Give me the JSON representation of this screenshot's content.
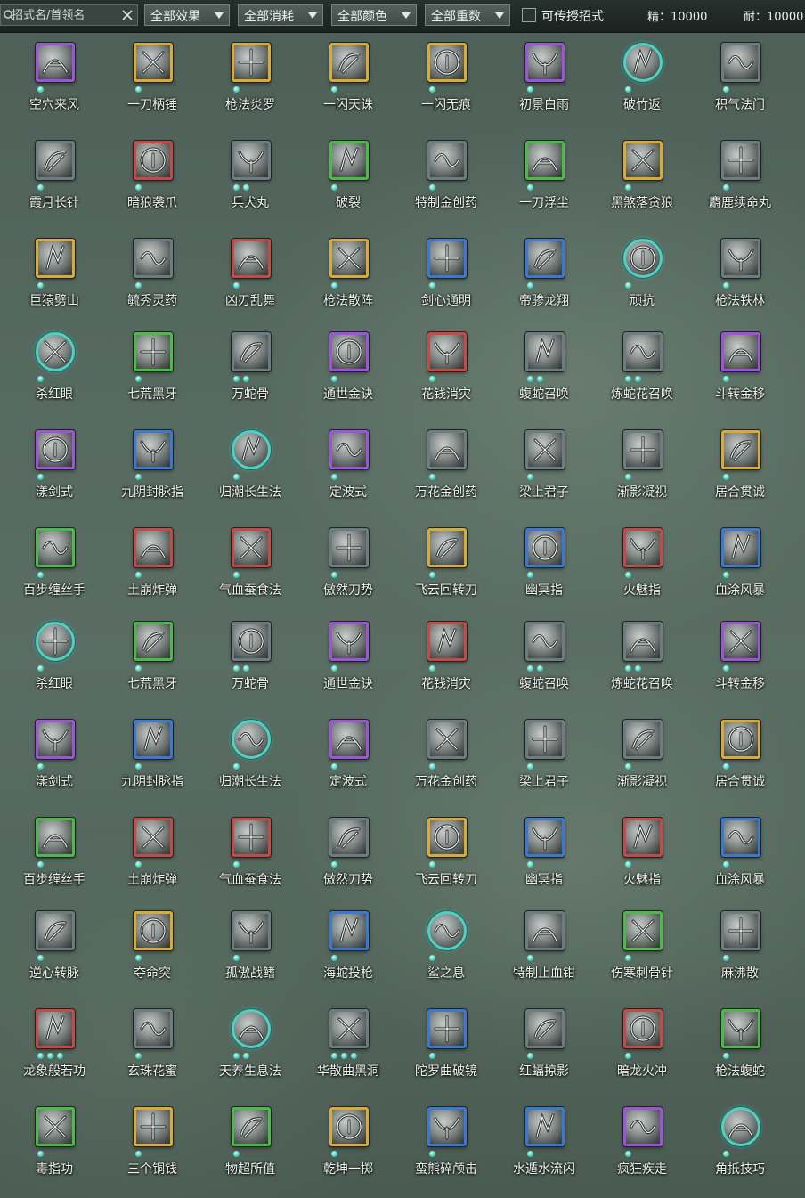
{
  "toolbar": {
    "search_placeholder": "招式名/首领名",
    "search_icon": "search-icon",
    "clear_icon": "close-icon",
    "filters": [
      {
        "label": "全部效果"
      },
      {
        "label": "全部消耗"
      },
      {
        "label": "全部颜色"
      },
      {
        "label": "全部重数"
      }
    ],
    "transferable_label": "可传授招式",
    "transferable_checked": false,
    "jing_label": "精：10000",
    "nai_label": "耐：10000",
    "jing_icon": "moon-crescent-purple-icon",
    "nai_icon": "moon-crescent-orange-icon"
  },
  "colors": {
    "purple": "#9b55d6",
    "gold": "#d7aa3a",
    "red": "#c44a47",
    "green": "#4fb84b",
    "blue": "#3d78d0",
    "gray": "#6d7c80",
    "teal": "#4fd0c2",
    "pip": "#43cdbb"
  },
  "skills": [
    [
      {
        "name": "空穴来风",
        "frame": "purple",
        "pips": 1
      },
      {
        "name": "一刀柄锤",
        "frame": "gold",
        "pips": 1
      },
      {
        "name": "枪法炎罗",
        "frame": "gold",
        "pips": 1
      },
      {
        "name": "一闪天诛",
        "frame": "gold",
        "pips": 1
      },
      {
        "name": "一闪无痕",
        "frame": "gold",
        "pips": 1
      },
      {
        "name": "初景白雨",
        "frame": "purple",
        "pips": 1
      },
      {
        "name": "破竹返",
        "frame": "round",
        "pips": 1
      },
      {
        "name": "积气法门",
        "frame": "gray",
        "pips": 1
      }
    ],
    [
      {
        "name": "霞月长针",
        "frame": "gray",
        "pips": 1
      },
      {
        "name": "暗狼袭爪",
        "frame": "red",
        "pips": 1
      },
      {
        "name": "兵犬丸",
        "frame": "gray",
        "pips": 2
      },
      {
        "name": "破裂",
        "frame": "green",
        "pips": 1
      },
      {
        "name": "特制金创药",
        "frame": "gray",
        "pips": 1
      },
      {
        "name": "一刀浮尘",
        "frame": "green",
        "pips": 1
      },
      {
        "name": "黑煞落贪狼",
        "frame": "gold",
        "pips": 1
      },
      {
        "name": "麝鹿续命丸",
        "frame": "gray",
        "pips": 1
      }
    ],
    [
      {
        "name": "巨猿劈山",
        "frame": "gold",
        "pips": 1
      },
      {
        "name": "毓秀灵药",
        "frame": "gray",
        "pips": 1
      },
      {
        "name": "凶刃乱舞",
        "frame": "red",
        "pips": 1
      },
      {
        "name": "枪法散阵",
        "frame": "gold",
        "pips": 1
      },
      {
        "name": "剑心通明",
        "frame": "blue",
        "pips": 1
      },
      {
        "name": "帝骖龙翔",
        "frame": "blue",
        "pips": 1
      },
      {
        "name": "顽抗",
        "frame": "round",
        "pips": 1
      },
      {
        "name": "枪法铁林",
        "frame": "gray",
        "pips": 1
      }
    ],
    [
      {
        "name": "杀红眼",
        "frame": "round",
        "pips": 1
      },
      {
        "name": "七荒黑牙",
        "frame": "green",
        "pips": 1
      },
      {
        "name": "万蛇骨",
        "frame": "gray",
        "pips": 2
      },
      {
        "name": "通世金诀",
        "frame": "purple",
        "pips": 1
      },
      {
        "name": "花钱消灾",
        "frame": "red",
        "pips": 1
      },
      {
        "name": "蝮蛇召唤",
        "frame": "gray",
        "pips": 2
      },
      {
        "name": "炼蛇花召唤",
        "frame": "gray",
        "pips": 2
      },
      {
        "name": "斗转金移",
        "frame": "purple",
        "pips": 1
      }
    ],
    [
      {
        "name": "漾剑式",
        "frame": "purple",
        "pips": 1
      },
      {
        "name": "九阴封脉指",
        "frame": "blue",
        "pips": 1
      },
      {
        "name": "归潮长生法",
        "frame": "round",
        "pips": 1
      },
      {
        "name": "定波式",
        "frame": "purple",
        "pips": 1
      },
      {
        "name": "万花金创药",
        "frame": "gray",
        "pips": 1
      },
      {
        "name": "梁上君子",
        "frame": "gray",
        "pips": 1
      },
      {
        "name": "渐影凝视",
        "frame": "gray",
        "pips": 1
      },
      {
        "name": "居合贯诚",
        "frame": "gold",
        "pips": 1
      }
    ],
    [
      {
        "name": "百步缠丝手",
        "frame": "green",
        "pips": 1
      },
      {
        "name": "土崩炸弹",
        "frame": "red",
        "pips": 1
      },
      {
        "name": "气血蚕食法",
        "frame": "red",
        "pips": 1
      },
      {
        "name": "傲然刀势",
        "frame": "gray",
        "pips": 1
      },
      {
        "name": "飞云回转刀",
        "frame": "gold",
        "pips": 1
      },
      {
        "name": "幽冥指",
        "frame": "blue",
        "pips": 1
      },
      {
        "name": "火魅指",
        "frame": "red",
        "pips": 1
      },
      {
        "name": "血涂风暴",
        "frame": "blue",
        "pips": 1
      }
    ],
    [
      {
        "name": "杀红眼",
        "frame": "round",
        "pips": 1
      },
      {
        "name": "七荒黑牙",
        "frame": "green",
        "pips": 1
      },
      {
        "name": "万蛇骨",
        "frame": "gray",
        "pips": 2
      },
      {
        "name": "通世金诀",
        "frame": "purple",
        "pips": 1
      },
      {
        "name": "花钱消灾",
        "frame": "red",
        "pips": 1
      },
      {
        "name": "蝮蛇召唤",
        "frame": "gray",
        "pips": 2
      },
      {
        "name": "炼蛇花召唤",
        "frame": "gray",
        "pips": 2
      },
      {
        "name": "斗转金移",
        "frame": "purple",
        "pips": 1
      }
    ],
    [
      {
        "name": "漾剑式",
        "frame": "purple",
        "pips": 1
      },
      {
        "name": "九阴封脉指",
        "frame": "blue",
        "pips": 1
      },
      {
        "name": "归潮长生法",
        "frame": "round",
        "pips": 1
      },
      {
        "name": "定波式",
        "frame": "purple",
        "pips": 1
      },
      {
        "name": "万花金创药",
        "frame": "gray",
        "pips": 1
      },
      {
        "name": "梁上君子",
        "frame": "gray",
        "pips": 1
      },
      {
        "name": "渐影凝视",
        "frame": "gray",
        "pips": 1
      },
      {
        "name": "居合贯诚",
        "frame": "gold",
        "pips": 1
      }
    ],
    [
      {
        "name": "百步缠丝手",
        "frame": "green",
        "pips": 1
      },
      {
        "name": "土崩炸弹",
        "frame": "red",
        "pips": 1
      },
      {
        "name": "气血蚕食法",
        "frame": "red",
        "pips": 1
      },
      {
        "name": "傲然刀势",
        "frame": "gray",
        "pips": 1
      },
      {
        "name": "飞云回转刀",
        "frame": "gold",
        "pips": 1
      },
      {
        "name": "幽冥指",
        "frame": "blue",
        "pips": 1
      },
      {
        "name": "火魅指",
        "frame": "red",
        "pips": 1
      },
      {
        "name": "血涂风暴",
        "frame": "blue",
        "pips": 1
      }
    ],
    [
      {
        "name": "逆心转脉",
        "frame": "gray",
        "pips": 1
      },
      {
        "name": "夺命突",
        "frame": "gold",
        "pips": 1
      },
      {
        "name": "孤傲战鳍",
        "frame": "gray",
        "pips": 1
      },
      {
        "name": "海蛇投枪",
        "frame": "blue",
        "pips": 1
      },
      {
        "name": "鲨之息",
        "frame": "round",
        "pips": 1
      },
      {
        "name": "特制止血钳",
        "frame": "gray",
        "pips": 1
      },
      {
        "name": "伤寒刺骨针",
        "frame": "green",
        "pips": 1
      },
      {
        "name": "麻沸散",
        "frame": "gray",
        "pips": 1
      }
    ],
    [
      {
        "name": "龙象般若功",
        "frame": "red",
        "pips": 3
      },
      {
        "name": "玄珠花蜜",
        "frame": "gray",
        "pips": 1
      },
      {
        "name": "天养生息法",
        "frame": "round",
        "pips": 2
      },
      {
        "name": "华散曲黑洞",
        "frame": "gray",
        "pips": 3
      },
      {
        "name": "陀罗曲破镜",
        "frame": "blue",
        "pips": 1
      },
      {
        "name": "红蝠掠影",
        "frame": "gray",
        "pips": 1
      },
      {
        "name": "暗龙火冲",
        "frame": "red",
        "pips": 1
      },
      {
        "name": "枪法蝮蛇",
        "frame": "green",
        "pips": 1
      }
    ],
    [
      {
        "name": "毒指功",
        "frame": "green",
        "pips": 1
      },
      {
        "name": "三个铜钱",
        "frame": "gold",
        "pips": 1
      },
      {
        "name": "物超所值",
        "frame": "green",
        "pips": 1
      },
      {
        "name": "乾坤一掷",
        "frame": "gold",
        "pips": 1
      },
      {
        "name": "蛮熊碎颅击",
        "frame": "blue",
        "pips": 1
      },
      {
        "name": "水遁水流闪",
        "frame": "blue",
        "pips": 1
      },
      {
        "name": "疯狂疾走",
        "frame": "purple",
        "pips": 1
      },
      {
        "name": "角抵技巧",
        "frame": "round",
        "pips": 1
      }
    ]
  ]
}
